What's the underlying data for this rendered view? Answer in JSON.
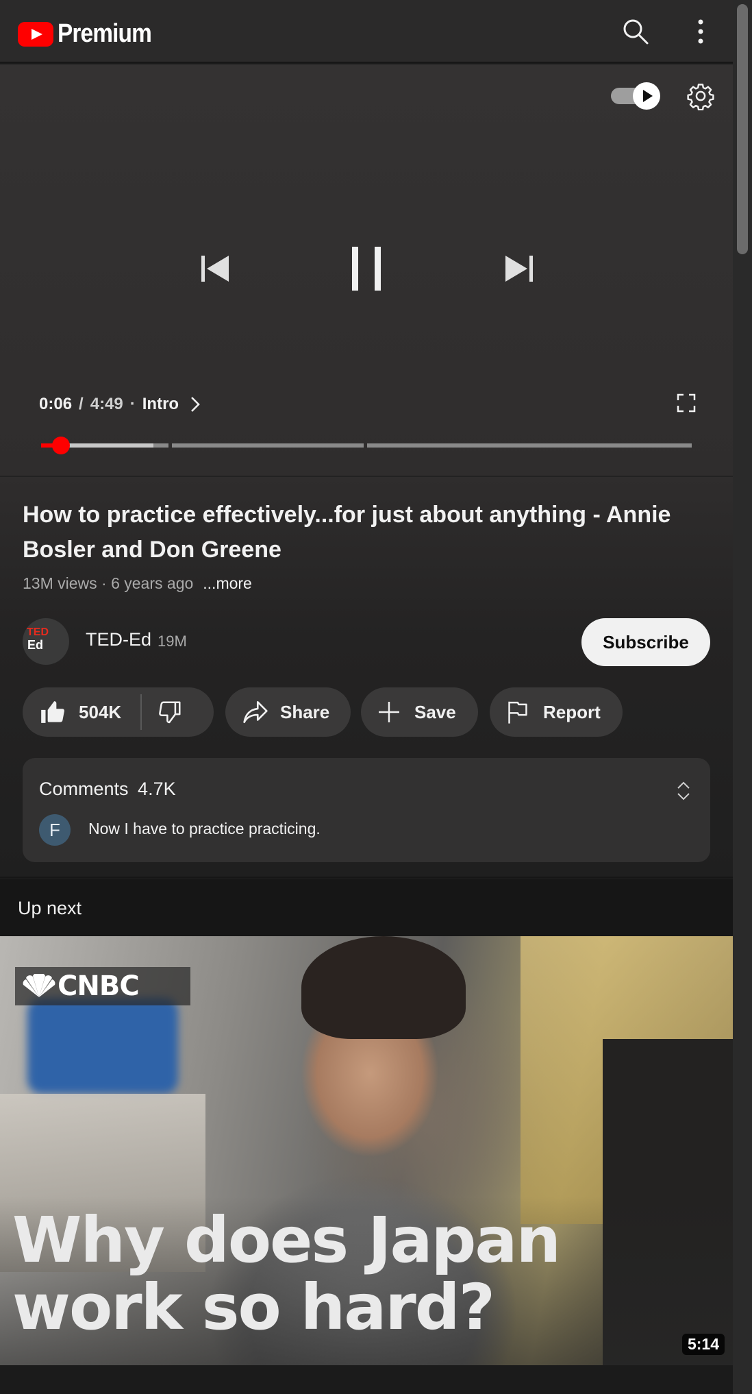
{
  "header": {
    "logo_text": "Premium"
  },
  "player": {
    "current_time": "0:06",
    "separator": "/",
    "duration": "4:49",
    "dot": "·",
    "chapter": "Intro",
    "progress": {
      "played_fraction": 0.031
    }
  },
  "video": {
    "title": "How to practice effectively...for just about anything - Annie Bosler and Don Greene",
    "meta": "13M views · 6 years ago",
    "more": "...more"
  },
  "channel": {
    "avatar_top": "TED",
    "avatar_bottom": "Ed",
    "name": "TED-Ed",
    "subscribers": "19M",
    "subscribe_label": "Subscribe"
  },
  "actions": {
    "likes": "504K",
    "share": "Share",
    "save": "Save",
    "report": "Report"
  },
  "comments": {
    "label": "Comments",
    "count": "4.7K",
    "preview_avatar": "F",
    "preview_text": "Now I have to practice practicing."
  },
  "up_next": {
    "label": "Up next",
    "thumbnail_brand": "CNBC",
    "thumbnail_title_line1": "Why does Japan",
    "thumbnail_title_line2": "work so hard?",
    "duration": "5:14"
  }
}
